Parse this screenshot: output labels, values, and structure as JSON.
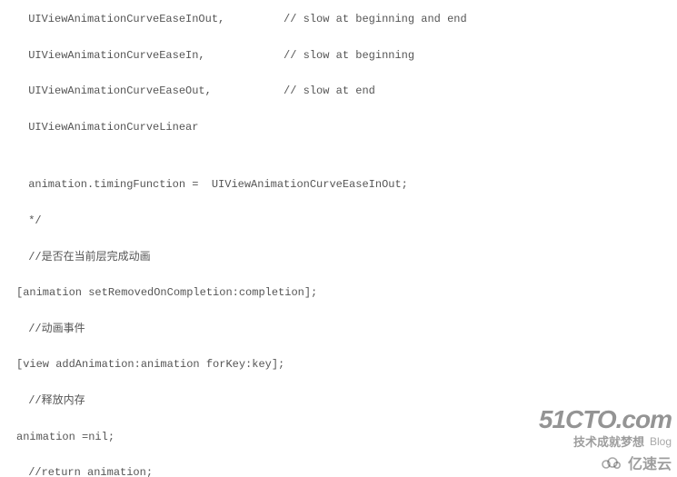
{
  "code": {
    "l1": " UIViewAnimationCurveEaseInOut,         // slow at beginning and end",
    "l2": " UIViewAnimationCurveEaseIn,            // slow at beginning",
    "l3": " UIViewAnimationCurveEaseOut,           // slow at end",
    "l4": " UIViewAnimationCurveLinear",
    "l5": " animation.timingFunction =  UIViewAnimationCurveEaseInOut;",
    "l6": " */",
    "l7": " //是否在当前层完成动画",
    "l8": "[animation setRemovedOnCompletion:completion];",
    "l9": " //动画事件",
    "l10": "[view addAnimation:animation forKey:key];",
    "l11": " //释放内存",
    "l12": "animation =nil;",
    "l13": " //return animation;"
  },
  "watermark": {
    "brand": "51CTO.com",
    "tagline_cn": "技术成就梦想",
    "tagline_en": "Blog",
    "secondary": "亿速云"
  }
}
